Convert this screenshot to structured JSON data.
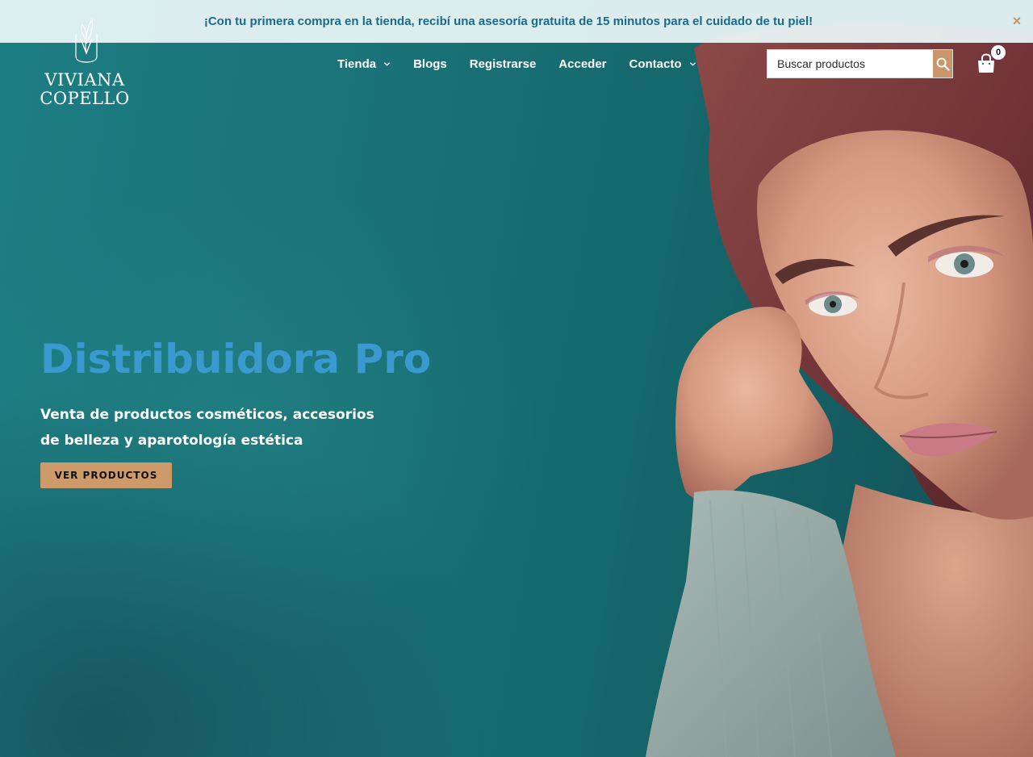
{
  "announcement": {
    "text": "¡Con tu primera compra en la tienda, recibí una asesoría gratuita de 15 minutos para el cuidado de tu piel!",
    "close_icon": "×"
  },
  "brand": {
    "line1": "VIVIANA",
    "line2": "COPELLO"
  },
  "nav": {
    "items": [
      {
        "label": "Tienda",
        "has_dropdown": true
      },
      {
        "label": "Blogs",
        "has_dropdown": false
      },
      {
        "label": "Registrarse",
        "has_dropdown": false
      },
      {
        "label": "Acceder",
        "has_dropdown": false
      },
      {
        "label": "Contacto",
        "has_dropdown": true
      }
    ]
  },
  "search": {
    "placeholder": "Buscar productos",
    "icon": "search-icon"
  },
  "cart": {
    "count": "0",
    "icon": "shopping-bag-icon"
  },
  "hero": {
    "title": "Distribuidora Pro",
    "subtitle": "Venta de productos cosméticos, accesorios de belleza y aparotología estética",
    "cta_label": "VER PRODUCTOS"
  },
  "colors": {
    "accent": "#c9966b",
    "title_blue": "#3a9ad0",
    "announcement_text": "#1c6a8a",
    "hero_background": "#1a7277"
  }
}
